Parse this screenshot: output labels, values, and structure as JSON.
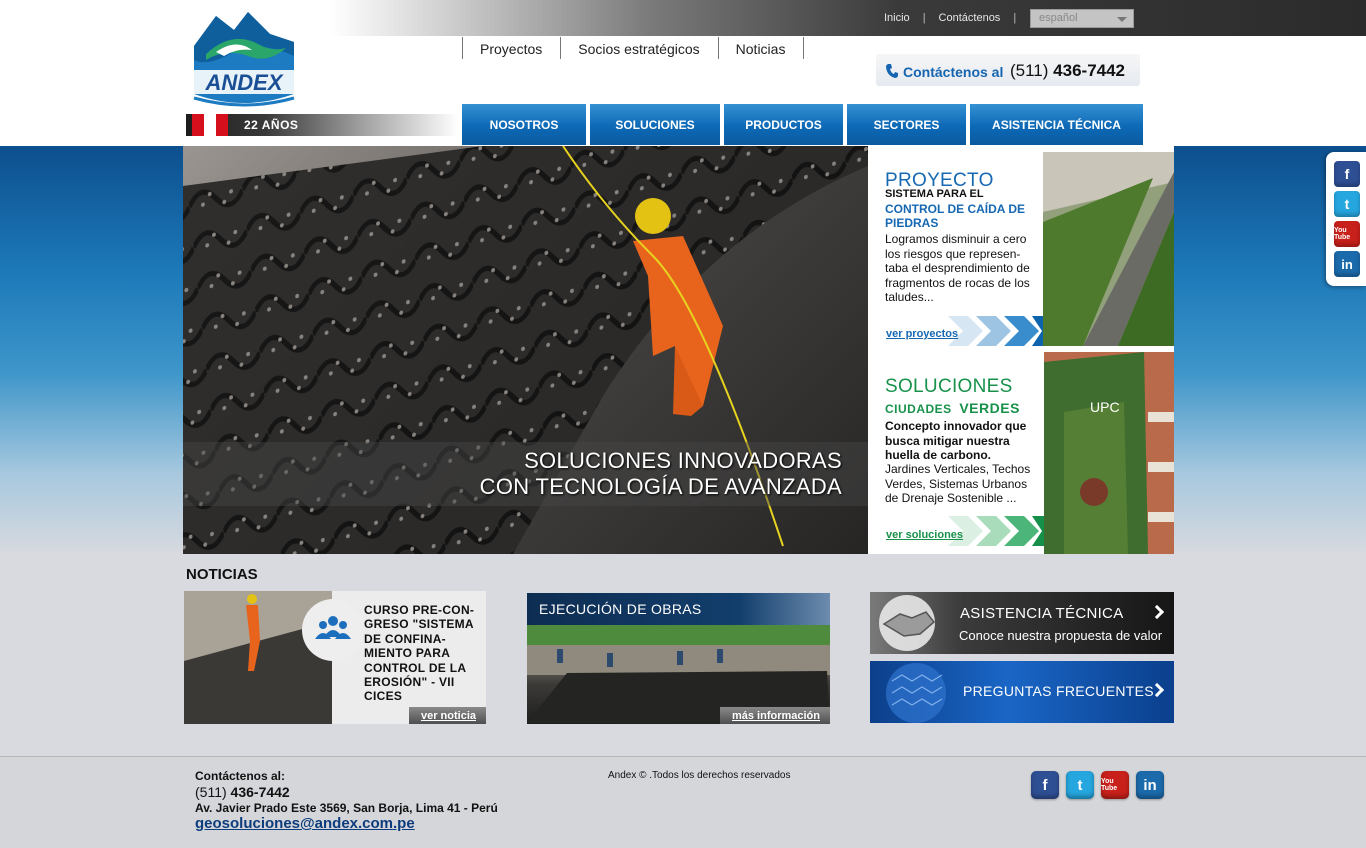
{
  "topbar": {
    "links": [
      "Inicio",
      "Contáctenos"
    ],
    "language": "español"
  },
  "logo": {
    "text": "ANDEX",
    "years": "22 AÑOS"
  },
  "subnav": [
    "Proyectos",
    "Socios estratégicos",
    "Noticias"
  ],
  "contact": {
    "label": "Contáctenos al",
    "prefix": "(511)",
    "number": "436-7442"
  },
  "mainnav": [
    "NOSOTROS",
    "SOLUCIONES",
    "PRODUCTOS",
    "SECTORES",
    "ASISTENCIA TÉCNICA"
  ],
  "hero": {
    "line1": "SOLUCIONES INNOVADORAS",
    "line2": "CON TECNOLOGÍA DE AVANZADA"
  },
  "panel_proyecto": {
    "title": "PROYECTO",
    "sub1": "SISTEMA PARA EL",
    "sub2": "CONTROL DE CAÍDA DE PIEDRAS",
    "body": "Logramos disminuir a cero los riesgos que represen-taba el desprendimiento de fragmentos de rocas de los taludes...",
    "more": "ver proyectos"
  },
  "panel_soluciones": {
    "title": "SOLUCIONES",
    "sub_small": "CIUDADES",
    "sub_big": "VERDES",
    "body_bold": "Concepto innovador que busca mitigar nuestra huella de carbono.",
    "body": "Jardines Verticales, Techos Verdes, Sistemas Urbanos de Drenaje Sostenible ...",
    "more": "ver soluciones",
    "photo_sign": "UPC"
  },
  "social": {
    "facebook": "f",
    "twitter": "t",
    "youtube": "You Tube",
    "linkedin": "in"
  },
  "noticias": {
    "title": "NOTICIAS",
    "item1_text": "CURSO PRE-CON-GRESO \"SISTEMA DE CONFINA-MIENTO PARA CONTROL DE LA EROSIÓN\" - VII CICES",
    "item1_button": "ver noticia",
    "item2_title": "EJECUCIÓN DE OBRAS",
    "item2_button": "más información"
  },
  "promos": {
    "asistencia_title": "ASISTENCIA TÉCNICA",
    "asistencia_sub": "Conoce nuestra propuesta de valor",
    "faq_title": "PREGUNTAS FRECUENTES"
  },
  "footer": {
    "label": "Contáctenos al:",
    "phone_prefix": "(511)",
    "phone_number": "436-7442",
    "address": "Av. Javier Prado Este 3569, San Borja, Lima 41 - Perú",
    "email": "geosoluciones@andex.com.pe",
    "copyright": "Andex © .Todos los derechos reservados"
  }
}
